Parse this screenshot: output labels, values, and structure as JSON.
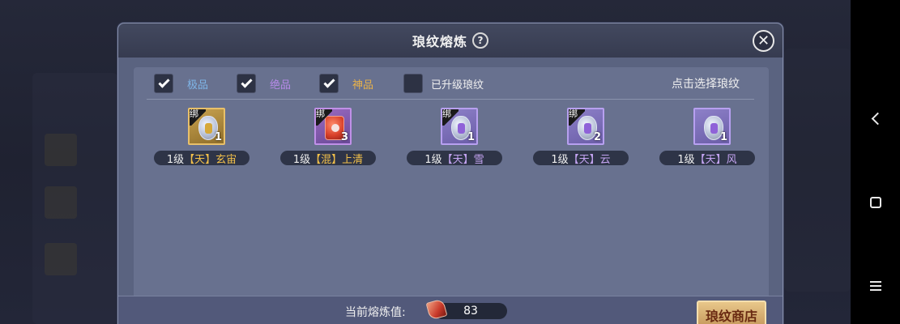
{
  "dialog": {
    "title": "琅纹熔炼",
    "help_glyph": "?",
    "close_glyph": "✕"
  },
  "filters": [
    {
      "label": "极品",
      "checked": true,
      "color": "#7fb6e8"
    },
    {
      "label": "绝品",
      "checked": true,
      "color": "#b68ae8"
    },
    {
      "label": "神品",
      "checked": true,
      "color": "#e8b24a"
    },
    {
      "label": "已升级琅纹",
      "checked": false,
      "color": "#f0f0f0"
    }
  ],
  "hint": "点击选择琅纹",
  "items": [
    {
      "bind": "绑",
      "count": "1",
      "level": "1级",
      "tag": "【天】",
      "name": "玄宙",
      "rarity": "gold"
    },
    {
      "bind": "绑",
      "count": "3",
      "level": "1级",
      "tag": "【混】",
      "name": "上清",
      "rarity": "red"
    },
    {
      "bind": "绑",
      "count": "1",
      "level": "1级",
      "tag": "【天】",
      "name": "雪",
      "rarity": "purple"
    },
    {
      "bind": "绑",
      "count": "2",
      "level": "1级",
      "tag": "【天】",
      "name": "云",
      "rarity": "purple"
    },
    {
      "bind": "",
      "count": "1",
      "level": "1级",
      "tag": "【天】",
      "name": "风",
      "rarity": "purple"
    }
  ],
  "footer": {
    "label": "当前熔炼值:",
    "value": "83",
    "shop_button": "琅纹商店"
  },
  "colors": {
    "accent_gold": "#f2c04a",
    "accent_purple": "#c4a4f2",
    "dialog_bg": "#5a6380"
  }
}
